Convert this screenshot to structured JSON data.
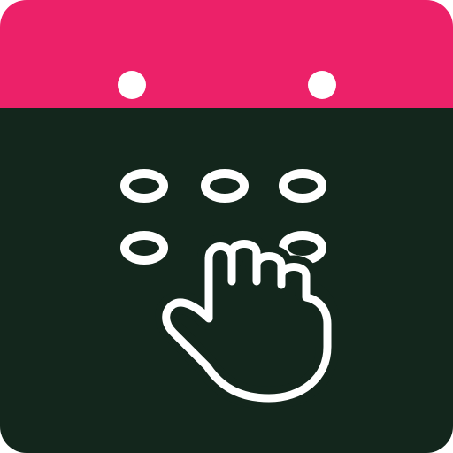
{
  "icon": {
    "name": "calendar-keypad-touch-icon",
    "colors": {
      "header": "#EC2169",
      "body": "#13261C",
      "dots": "#ffffff",
      "hand_stroke": "#ffffff"
    }
  }
}
